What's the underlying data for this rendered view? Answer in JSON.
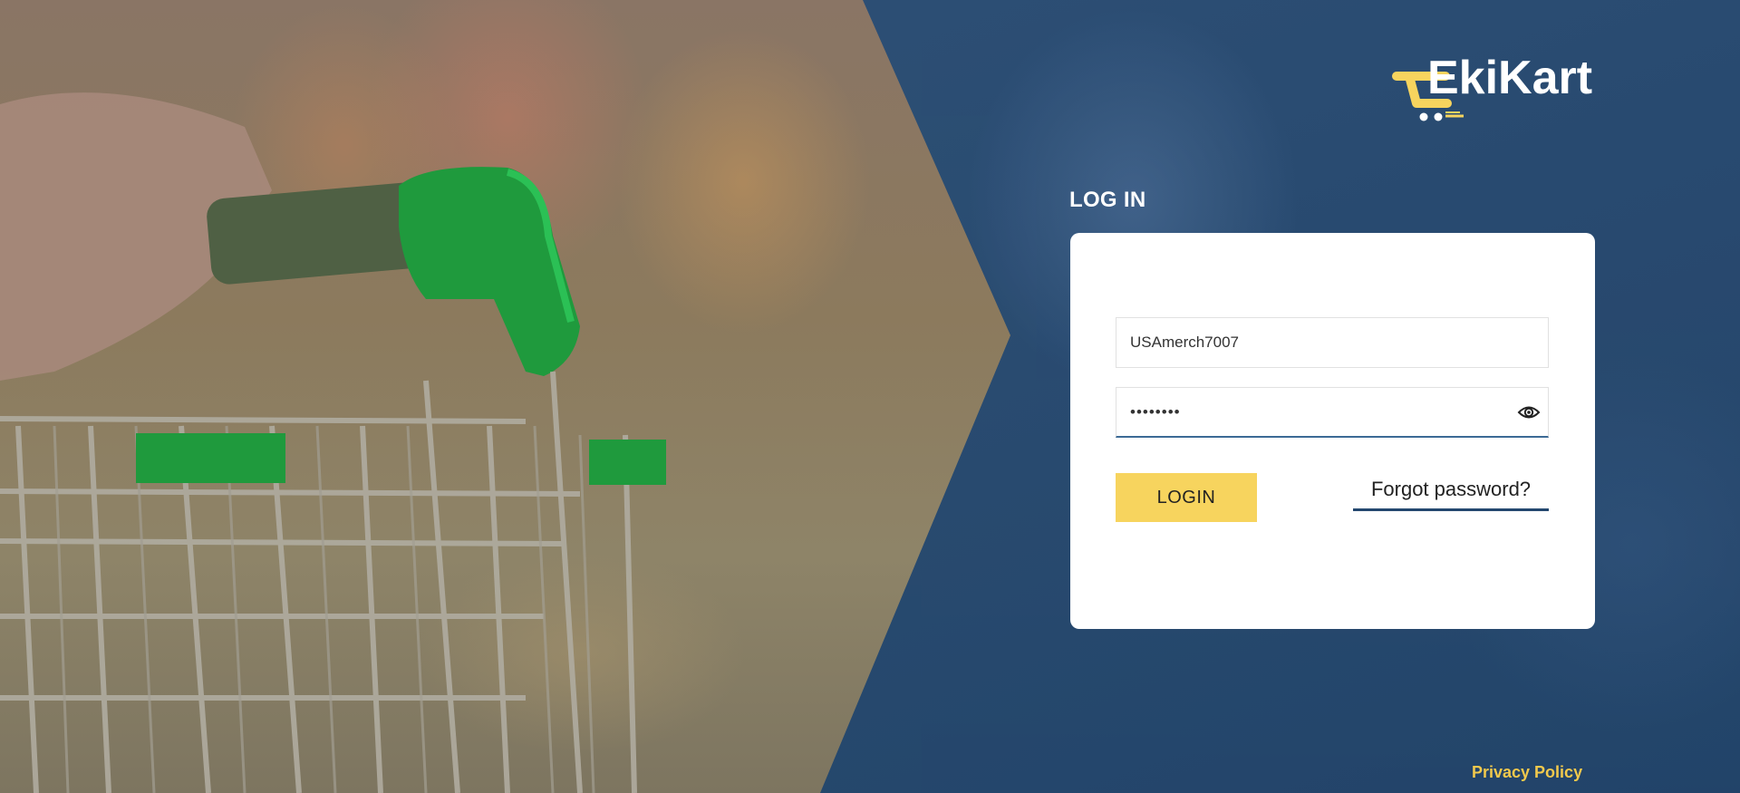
{
  "brand": {
    "logo_text": "EkiKart"
  },
  "login": {
    "heading": "LOG IN",
    "username_value": "USAmerch7007",
    "password_value": "••••••••",
    "login_button_label": "LOGIN",
    "forgot_password_label": "Forgot password?"
  },
  "footer": {
    "privacy_label": "Privacy Policy"
  },
  "icons": {
    "password_toggle": "eye-icon",
    "logo_cart": "shopping-cart-icon"
  },
  "colors": {
    "accent_yellow": "#f7d45e",
    "brand_blue": "#24486f",
    "link_yellow": "#f2c94c"
  }
}
